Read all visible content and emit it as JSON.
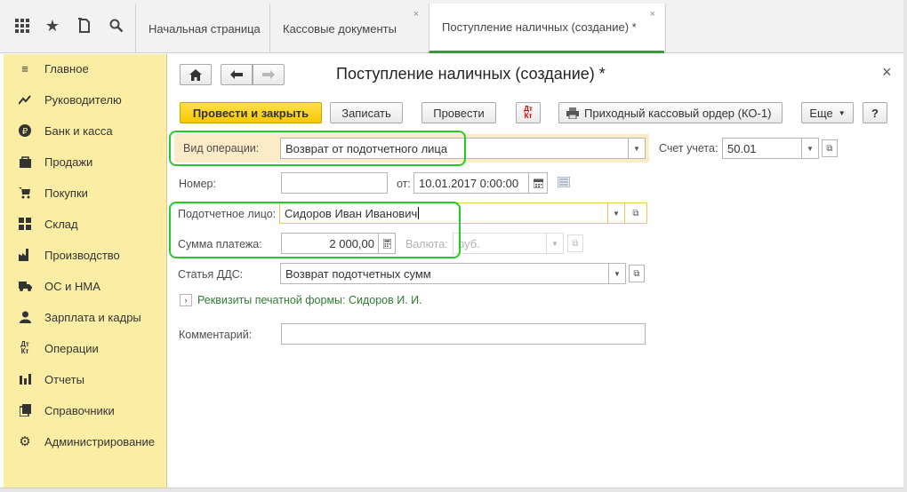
{
  "topbar": {
    "icons": [
      "grid-icon",
      "star-icon",
      "history-icon",
      "search-icon"
    ],
    "tabs": [
      {
        "label": "Начальная страница",
        "closable": false
      },
      {
        "label": "Кассовые документы",
        "closable": true
      },
      {
        "label": "Поступление наличных (создание) *",
        "closable": true,
        "active": true
      }
    ]
  },
  "sidebar": {
    "items": [
      {
        "label": "Главное",
        "icon": "menu-lines-icon"
      },
      {
        "label": "Руководителю",
        "icon": "trend-icon"
      },
      {
        "label": "Банк и касса",
        "icon": "ruble-coin-icon"
      },
      {
        "label": "Продажи",
        "icon": "shopping-bag-icon"
      },
      {
        "label": "Покупки",
        "icon": "cart-icon"
      },
      {
        "label": "Склад",
        "icon": "warehouse-icon"
      },
      {
        "label": "Производство",
        "icon": "factory-icon"
      },
      {
        "label": "ОС и НМА",
        "icon": "truck-icon"
      },
      {
        "label": "Зарплата и кадры",
        "icon": "person-icon"
      },
      {
        "label": "Операции",
        "icon": "dt-kt-icon"
      },
      {
        "label": "Отчеты",
        "icon": "bar-chart-icon"
      },
      {
        "label": "Справочники",
        "icon": "books-icon"
      },
      {
        "label": "Администрирование",
        "icon": "gear-icon"
      }
    ]
  },
  "form": {
    "title": "Поступление наличных (создание) *",
    "close_symbol": "×",
    "buttons": {
      "post_close": "Провести и закрыть",
      "save": "Записать",
      "post": "Провести",
      "print": "Приходный кассовый ордер (КО-1)",
      "more": "Еще",
      "help": "?",
      "dtkt": "Дт Кт"
    },
    "operation_label": "Вид операции:",
    "operation_value": "Возврат от подотчетного лица",
    "account_label": "Счет учета:",
    "account_value": "50.01",
    "number_label": "Номер:",
    "number_value": "",
    "date_from_label": "от:",
    "date_value": "10.01.2017  0:00:00",
    "person_label": "Подотчетное лицо:",
    "person_value": "Сидоров Иван Иванович",
    "amount_label": "Сумма платежа:",
    "amount_value": "2 000,00",
    "currency_label": "Валюта:",
    "currency_value": "руб.",
    "dds_label": "Статья ДДС:",
    "dds_value": "Возврат подотчетных сумм",
    "print_details_link": "Реквизиты печатной формы: Сидоров И. И.",
    "comment_label": "Комментарий:",
    "comment_value": ""
  },
  "colors": {
    "sidebar_bg": "#fbeea4",
    "primary_button": "#f5c800",
    "highlight": "#22cc22",
    "active_tab": "#3a9a3a",
    "link": "#2e7d32"
  }
}
